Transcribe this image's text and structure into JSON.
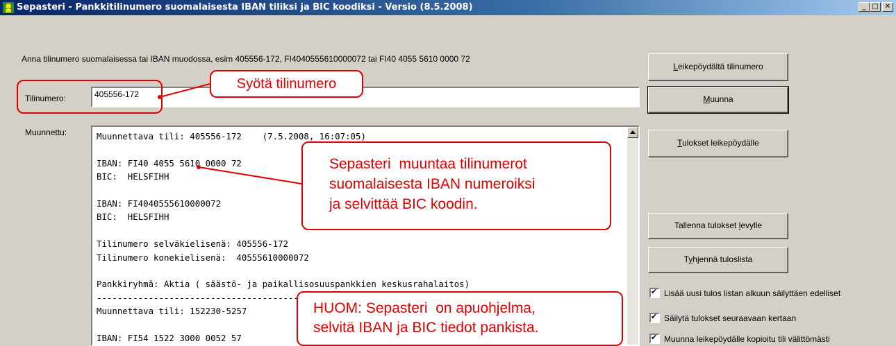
{
  "window": {
    "title": "Sepasteri - Pankkitilinumero suomalaisesta IBAN tiliksi ja BIC koodiksi - Versio (8.5.2008)",
    "minimize": "_",
    "maximize": "□",
    "close": "✕"
  },
  "instruction": "Anna tilinumero suomalaisessa tai IBAN muodossa, esim 405556-172, FI4040555610000072 tai FI40 4055 5610 0000 72",
  "account": {
    "label": "Tilinumero:",
    "value": "405556-172"
  },
  "converted": {
    "label": "Muunnettu:",
    "text": "Muunnettava tili: 405556-172    (7.5.2008, 16:07:05)\n\nIBAN: FI40 4055 5610 0000 72\nBIC:  HELSFIHH\n\nIBAN: FI4040555610000072\nBIC:  HELSFIHH\n\nTilinumero selväkielisenä: 405556-172\nTilinumero konekielisenä:  40555610000072\n\nPankkiryhmä: Aktia ( säästö- ja paikallisosuuspankkien keskusrahalaitos)\n---------------------------------------------------------------------\nMuunnettava tili: 152230-5257\n\nIBAN: FI54 1522 3000 0052 57"
  },
  "buttons": {
    "paste": {
      "accel": "L",
      "rest": "eikepöydältä tilinumero"
    },
    "convert": {
      "accel": "M",
      "rest": "uunna"
    },
    "copy_results": {
      "accel": "T",
      "rest": "ulokset leikepöydälle"
    },
    "save": {
      "pre": "Tallenna tulokset ",
      "accel": "l",
      "rest": "evylle"
    },
    "clear": {
      "pre": "T",
      "accel": "y",
      "rest": "hjennä tuloslista"
    }
  },
  "options": [
    {
      "label": "Lisää uusi tulos listan alkuun säilyttäen edelliset",
      "checked": true
    },
    {
      "label": "Säilytä tulokset seuraavaan kertaan",
      "checked": true
    },
    {
      "label": "Muunna leikepöydälle kopioitu tili välittömästi",
      "checked": true
    }
  ],
  "annotations": {
    "enter_account": "Syötä tilinumero",
    "description": "Sepasteri  muuntaa tilinumerot\nsuomalaisesta IBAN numeroiksi\nja selvittää BIC koodin.",
    "note": "HUOM: Sepasteri  on apuohjelma,\nselvitä IBAN ja BIC tiedot pankista."
  },
  "colors": {
    "annotation_red": "#e00000",
    "titlebar": "#0a246a",
    "window_bg": "#d4d0c8"
  }
}
